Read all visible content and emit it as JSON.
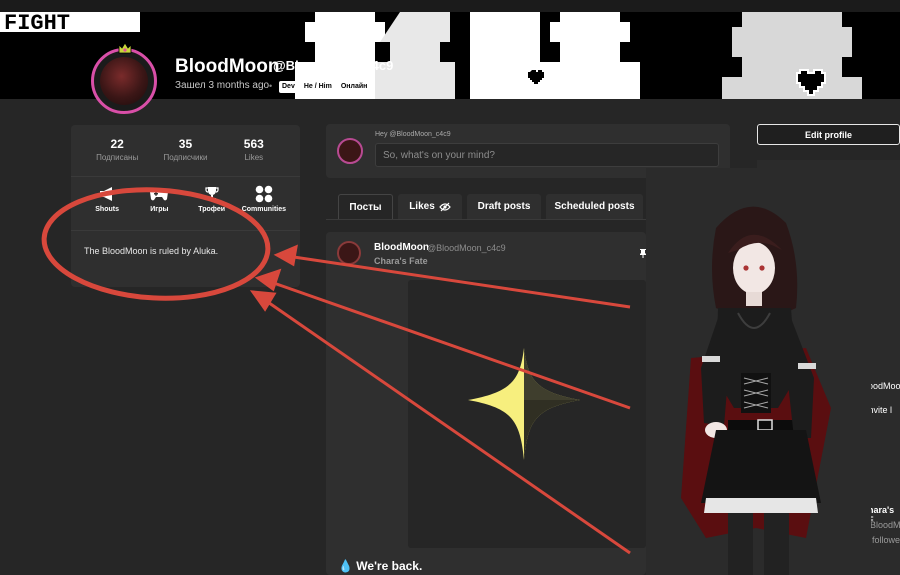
{
  "banner": {
    "logo_text": "FIGHT"
  },
  "profile": {
    "name": "BloodMoon",
    "handle": "@BloodMoon_c4c9",
    "last_seen": "Зашел 3 months ago",
    "separator": "•",
    "badges": [
      "Dev",
      "He / Him",
      "Онлайн"
    ]
  },
  "stats": [
    {
      "value": "22",
      "label": "Подписаны"
    },
    {
      "value": "35",
      "label": "Подписчики"
    },
    {
      "value": "563",
      "label": "Likes"
    }
  ],
  "sections": [
    {
      "label": "Shouts",
      "icon": "megaphone-icon"
    },
    {
      "label": "Игры",
      "icon": "gamepad-icon"
    },
    {
      "label": "Трофеи",
      "icon": "trophy-icon"
    },
    {
      "label": "Communities",
      "icon": "grid-icon"
    }
  ],
  "bio": "The BloodMoon is ruled by Aluka.",
  "compose": {
    "greeting": "Hey @BloodMoon_c4c9",
    "placeholder": "So, what's on your mind?"
  },
  "tabs": [
    {
      "label": "Посты",
      "active": true
    },
    {
      "label": "Likes",
      "icon": "eye-slash-icon"
    },
    {
      "label": "Draft posts"
    },
    {
      "label": "Scheduled posts"
    }
  ],
  "post": {
    "author": "BloodMoon",
    "handle": "@BloodMoon_c4c9",
    "title": "Chara's Fate",
    "footer_text": "We're back.",
    "footer_icon": "blood-drop-icon",
    "pin_icon": "pin-icon"
  },
  "sidebar": {
    "edit_profile": "Edit profile",
    "peek_1": "oodMoon",
    "peek_2": "r invite l",
    "peek_3": "hara's F",
    "peek_4": "BloodM",
    "peek_5": "followe"
  },
  "colors": {
    "accent_ring": "#d94fa8",
    "annotation": "#d8483c",
    "background": "#262626",
    "card": "#2f2f2f"
  }
}
